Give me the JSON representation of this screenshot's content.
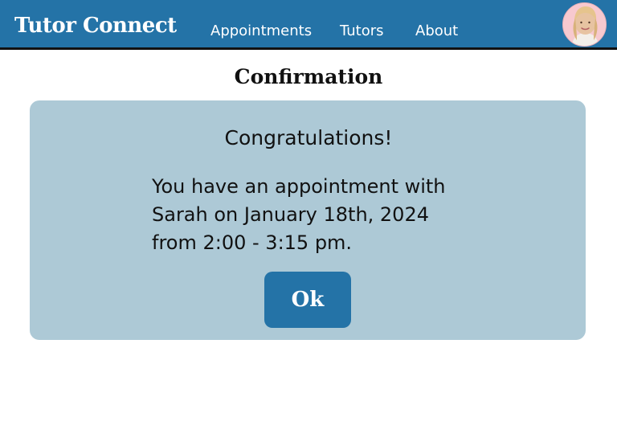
{
  "app": {
    "title": "Tutor Connect"
  },
  "nav": {
    "items": [
      {
        "label": "Appointments"
      },
      {
        "label": "Tutors"
      },
      {
        "label": "About"
      }
    ]
  },
  "page": {
    "title": "Confirmation"
  },
  "confirmation": {
    "heading": "Congratulations!",
    "message_lines": [
      "You have an appointment with",
      "Sarah on January 18th, 2024",
      "from 2:00 - 3:15 pm."
    ],
    "ok_label": "Ok"
  },
  "colors": {
    "header_bg": "#2473a7",
    "card_bg": "#adc9d6",
    "button_bg": "#2473a7",
    "avatar_bg": "#f7c9cf"
  },
  "icons": {
    "avatar": "user-avatar-icon"
  }
}
